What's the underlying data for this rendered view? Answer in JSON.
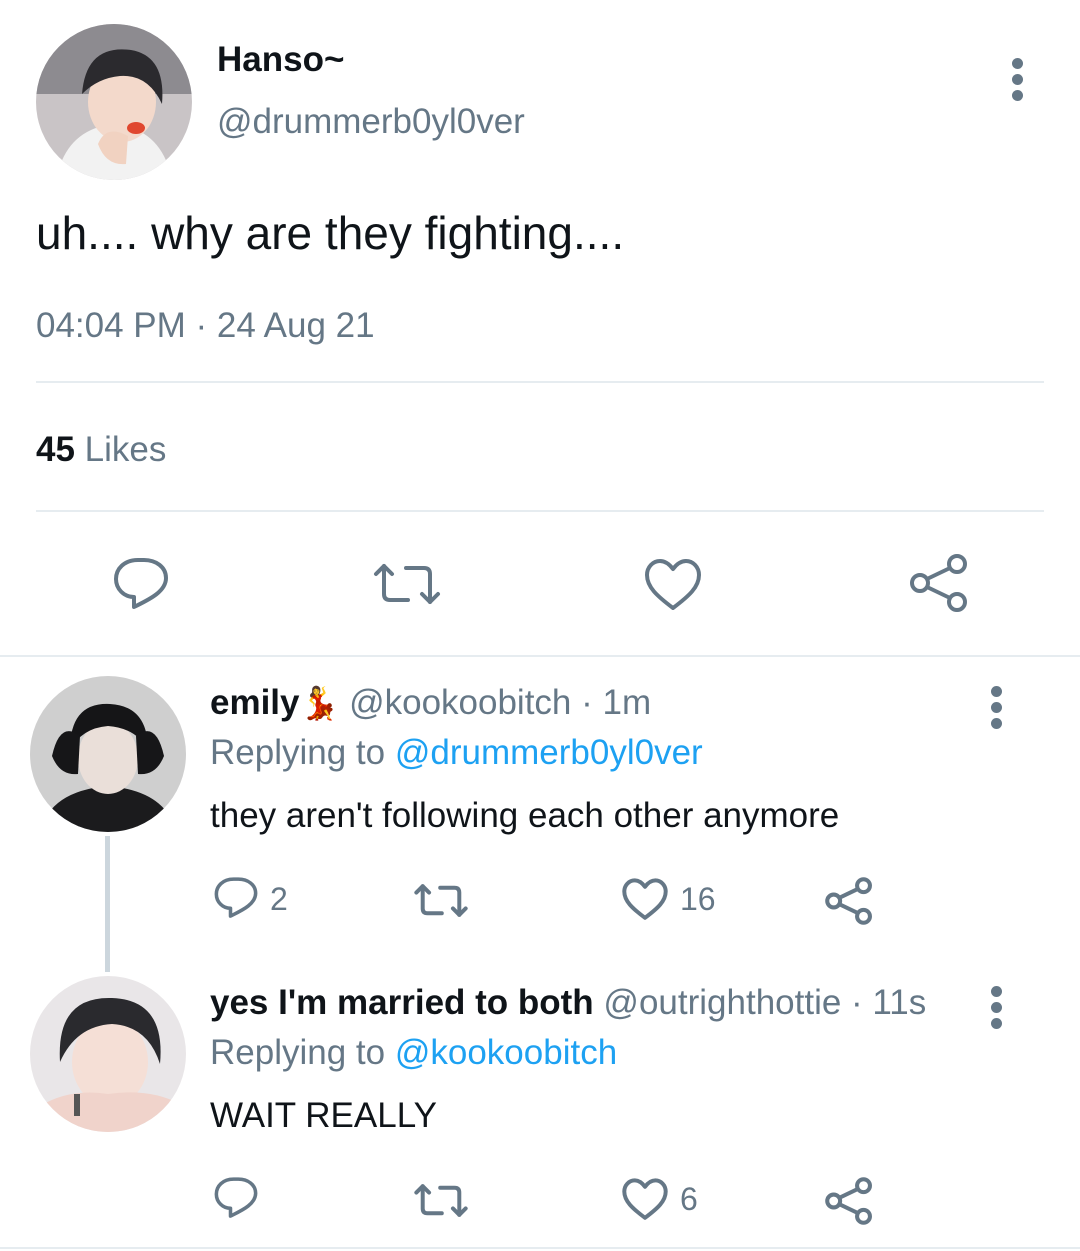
{
  "main_tweet": {
    "display_name": "Hanso~",
    "handle": "@drummerb0yl0ver",
    "text": "uh.... why are they fighting....",
    "timestamp": "04:04 PM · 24 Aug 21",
    "likes_count": "45",
    "likes_label": "Likes"
  },
  "replies": [
    {
      "display_name": "emily",
      "emoji": "💃",
      "handle": "@kookoobitch",
      "time": "· 1m",
      "replying_label": "Replying to",
      "replying_to": "@drummerb0yl0ver",
      "text": "they aren't following each other anymore",
      "reply_count": "2",
      "retweet_count": "",
      "like_count": "16"
    },
    {
      "display_name": "yes I'm married to both",
      "handle": "@outrighthottie",
      "time": "· 11s",
      "replying_label": "Replying to",
      "replying_to": "@kookoobitch",
      "text": "WAIT REALLY",
      "reply_count": "",
      "retweet_count": "",
      "like_count": "6"
    }
  ],
  "colors": {
    "accent": "#1da1f2",
    "muted": "#657786",
    "text": "#0f1419",
    "divider": "#e6ecf0"
  },
  "icons": [
    "more-options-icon",
    "reply-icon",
    "retweet-icon",
    "like-icon",
    "share-icon"
  ]
}
